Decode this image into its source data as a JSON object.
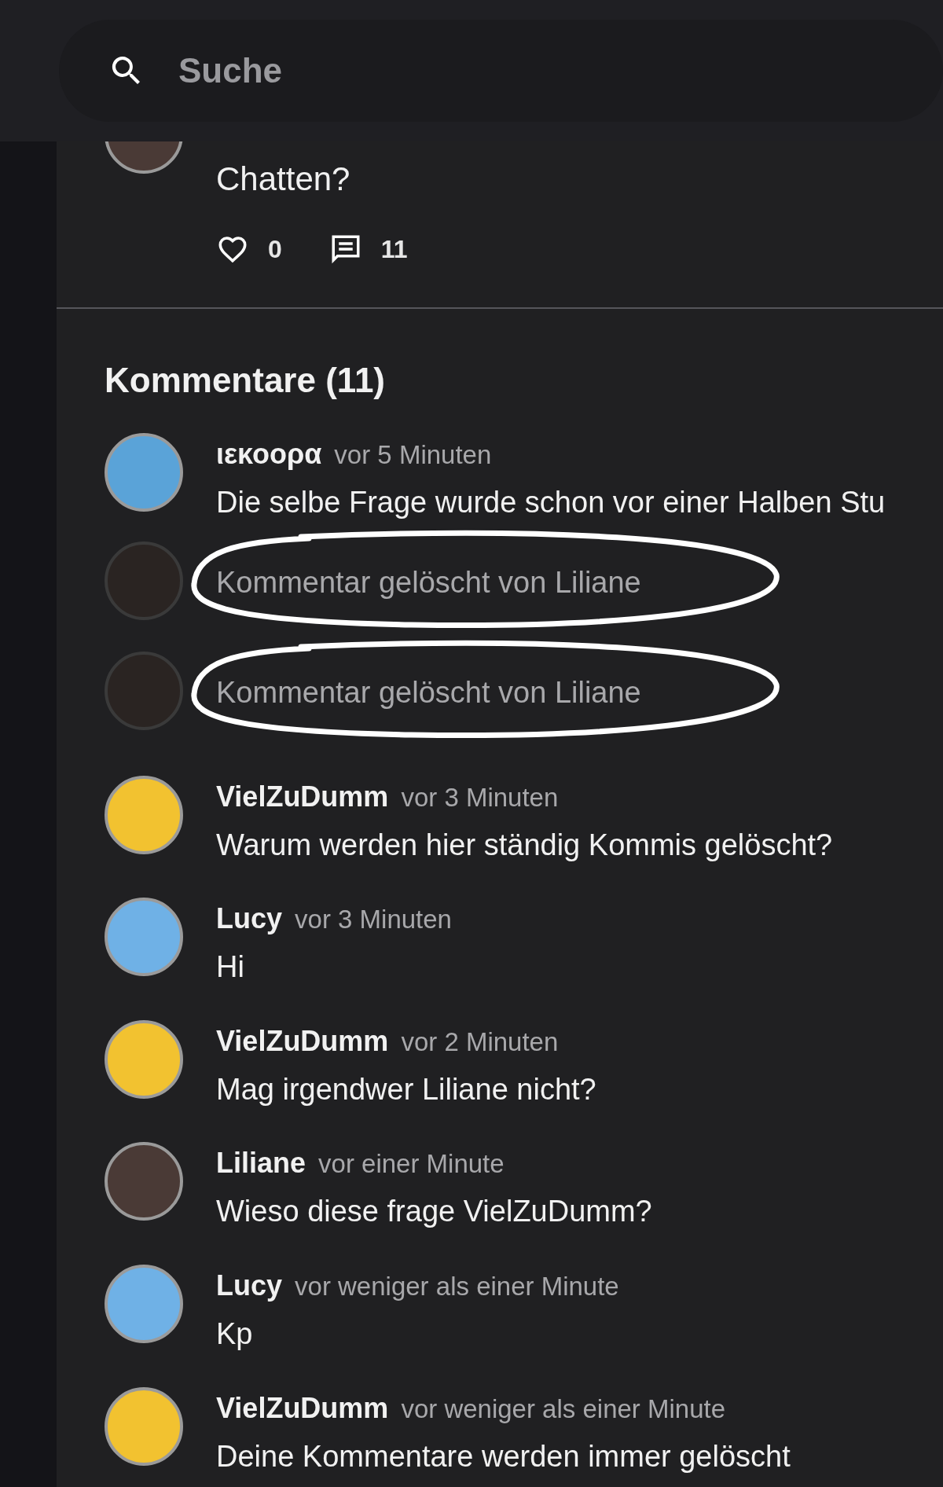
{
  "search": {
    "placeholder": "Suche"
  },
  "post": {
    "text": "Chatten?",
    "likes": "0",
    "comments": "11"
  },
  "comments_heading": "Kommentare (11)",
  "comments": [
    {
      "kind": "comment",
      "author": "ιεκοορα",
      "time": "vor 5 Minuten",
      "text": "Die selbe Frage wurde schon vor einer Halben Stu",
      "color": "#5aa3d8",
      "circled": false
    },
    {
      "kind": "deleted",
      "text": "Kommentar gelöscht von Liliane",
      "color": "#2a2422",
      "circled": true
    },
    {
      "kind": "deleted",
      "text": "Kommentar gelöscht von Liliane",
      "color": "#2a2422",
      "circled": true
    },
    {
      "kind": "comment",
      "author": "VielZuDumm",
      "time": "vor 3 Minuten",
      "text": "Warum werden hier ständig Kommis gelöscht?",
      "color": "#f2c230",
      "circled": false
    },
    {
      "kind": "comment",
      "author": "Lucy",
      "time": "vor 3 Minuten",
      "text": "Hi",
      "color": "#6fb1e6",
      "circled": false
    },
    {
      "kind": "comment",
      "author": "VielZuDumm",
      "time": "vor 2 Minuten",
      "text": "Mag irgendwer Liliane nicht?",
      "color": "#f2c230",
      "circled": false
    },
    {
      "kind": "comment",
      "author": "Liliane",
      "time": "vor einer Minute",
      "text": "Wieso diese frage VielZuDumm?",
      "color": "#4a3a36",
      "circled": false
    },
    {
      "kind": "comment",
      "author": "Lucy",
      "time": "vor weniger als einer Minute",
      "text": "Kp",
      "color": "#6fb1e6",
      "circled": false
    },
    {
      "kind": "comment",
      "author": "VielZuDumm",
      "time": "vor weniger als einer Minute",
      "text": "Deine Kommentare werden immer gelöscht",
      "color": "#f2c230",
      "circled": false
    }
  ]
}
